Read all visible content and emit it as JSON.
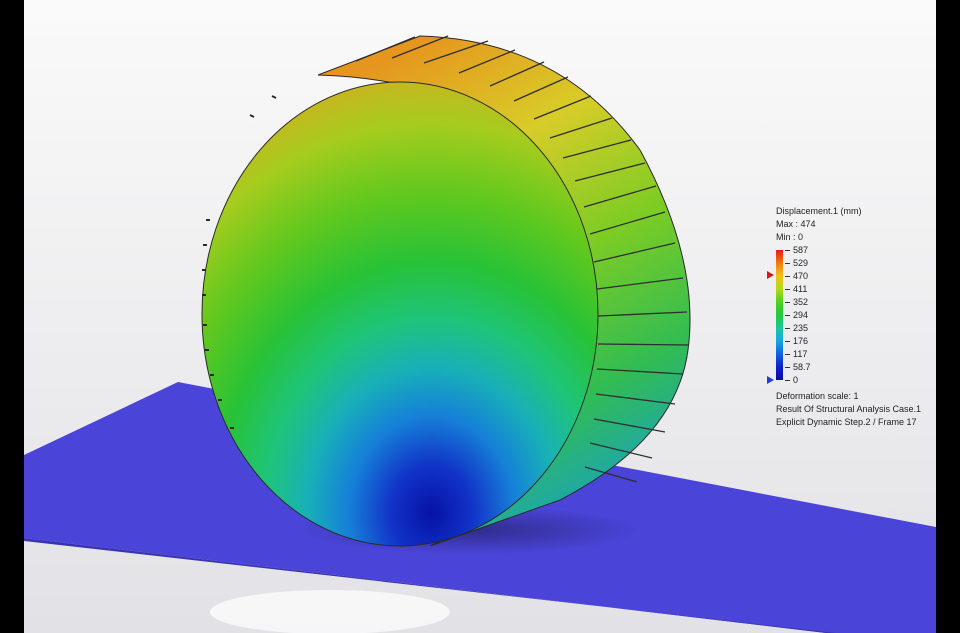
{
  "legend": {
    "title": "Displacement.1 (mm)",
    "max_text": "Max : 474",
    "min_text": "Min : 0",
    "scale_values": [
      "587",
      "529",
      "470",
      "411",
      "352",
      "294",
      "235",
      "176",
      "117",
      "58.7",
      "0"
    ],
    "max_value": 474,
    "min_value": 0,
    "scale_max": 587,
    "scale_min": 0,
    "colors": [
      "#e61e14",
      "#f07a12",
      "#f2c21a",
      "#b4d81c",
      "#4fd020",
      "#22c83a",
      "#1cc6a0",
      "#16a8e0",
      "#1262e0",
      "#1020c8",
      "#0a0aa8"
    ]
  },
  "footer": {
    "deformation": "Deformation scale: 1",
    "result": "Result Of Structural Analysis Case.1",
    "step": "Explicit Dynamic Step.2 / Frame 17"
  },
  "scene": {
    "background": "#ececf0",
    "ground_color": "#4a44d8"
  }
}
